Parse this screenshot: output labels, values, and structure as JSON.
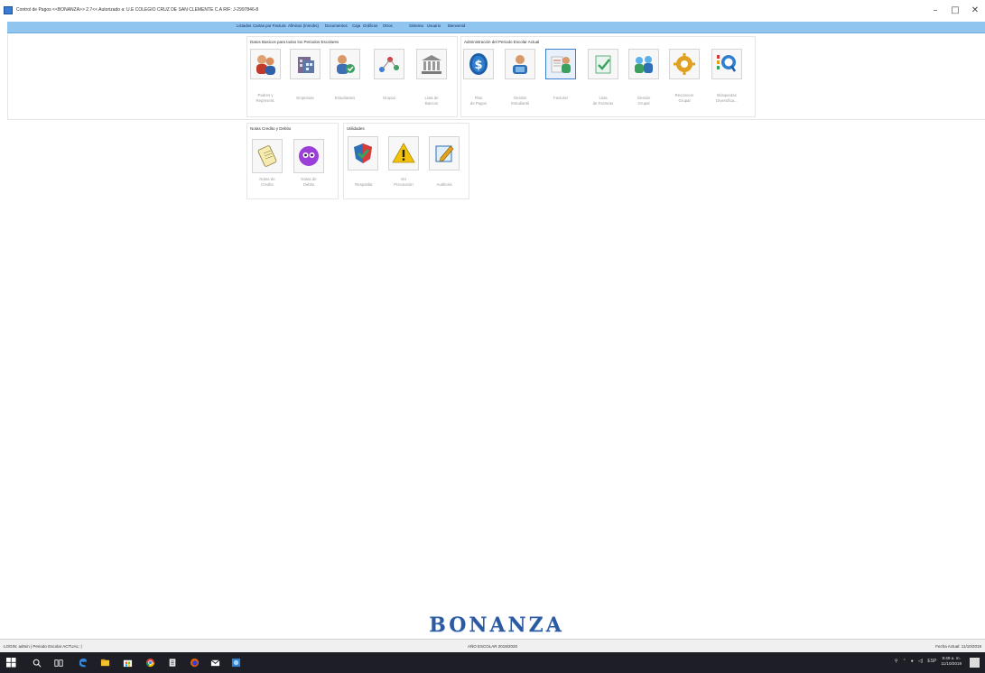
{
  "window": {
    "title": "Control de Pagos <<BONANZA>> 2.7<< Autorizado a: U.E COLEGIO CRUZ DE SAN CLEMENTE C.A RIF: J-2997846-8",
    "minimize": "–",
    "maximize": "□",
    "close": "✕"
  },
  "menu": {
    "items": [
      {
        "label": "Listados"
      },
      {
        "label": "Cartas por Factura"
      },
      {
        "label": "Afinisos (Inmobs)"
      },
      {
        "label": "Documentos"
      },
      {
        "label": "Caja"
      },
      {
        "label": "Gráficos"
      },
      {
        "label": "Otros"
      },
      {
        "label": "Sistema"
      },
      {
        "label": "Usuario"
      },
      {
        "label": "Bienvenid"
      }
    ]
  },
  "groups": {
    "datos_basicos": {
      "label": "Datos Basicos para todos los Periodos Escolares",
      "tiles": [
        {
          "label": "Padres y\nRepresent."
        },
        {
          "label": "Empresas"
        },
        {
          "label": "Estudiantes"
        },
        {
          "label": "Grupos"
        },
        {
          "label": "Lista de\nBancos"
        }
      ]
    },
    "administracion": {
      "label": "Administración del Periodo Escolar Actual",
      "tiles": [
        {
          "label": "Plan\nde Pagos"
        },
        {
          "label": "Gestión\nEstudiantil"
        },
        {
          "label": "Facturar"
        },
        {
          "label": "Lista\nde Facturas"
        },
        {
          "label": "Gestión\nGrupal"
        },
        {
          "label": "Reconocer\nGrupal"
        },
        {
          "label": "Búsquedas\nDiversifica..."
        }
      ]
    },
    "notas": {
      "label": "Notas Credito y Debito",
      "tiles": [
        {
          "label": "Notas de\nCredito"
        },
        {
          "label": "Notas de\nDebito"
        }
      ]
    },
    "utilidades": {
      "label": "Utilidades",
      "tiles": [
        {
          "label": "Respaldar"
        },
        {
          "label": "Ver\nPrecaución"
        },
        {
          "label": "Auditoria"
        }
      ]
    }
  },
  "logo": {
    "text": "BONANZA"
  },
  "status": {
    "left": "LOGIN: admin  |  Periodo Escolar ACTUAL: |",
    "center": "AÑO ESCOLAR 2019/2020",
    "right": "Fecha Actual: 11/10/2019"
  },
  "taskbar": {
    "time": "8:49 a. m.",
    "date": "11/10/2019",
    "lang": "ESP"
  },
  "colors": {
    "menubar": "#8fc5ee",
    "taskbar": "#1d1e26",
    "accent": "#2c5aa0"
  }
}
